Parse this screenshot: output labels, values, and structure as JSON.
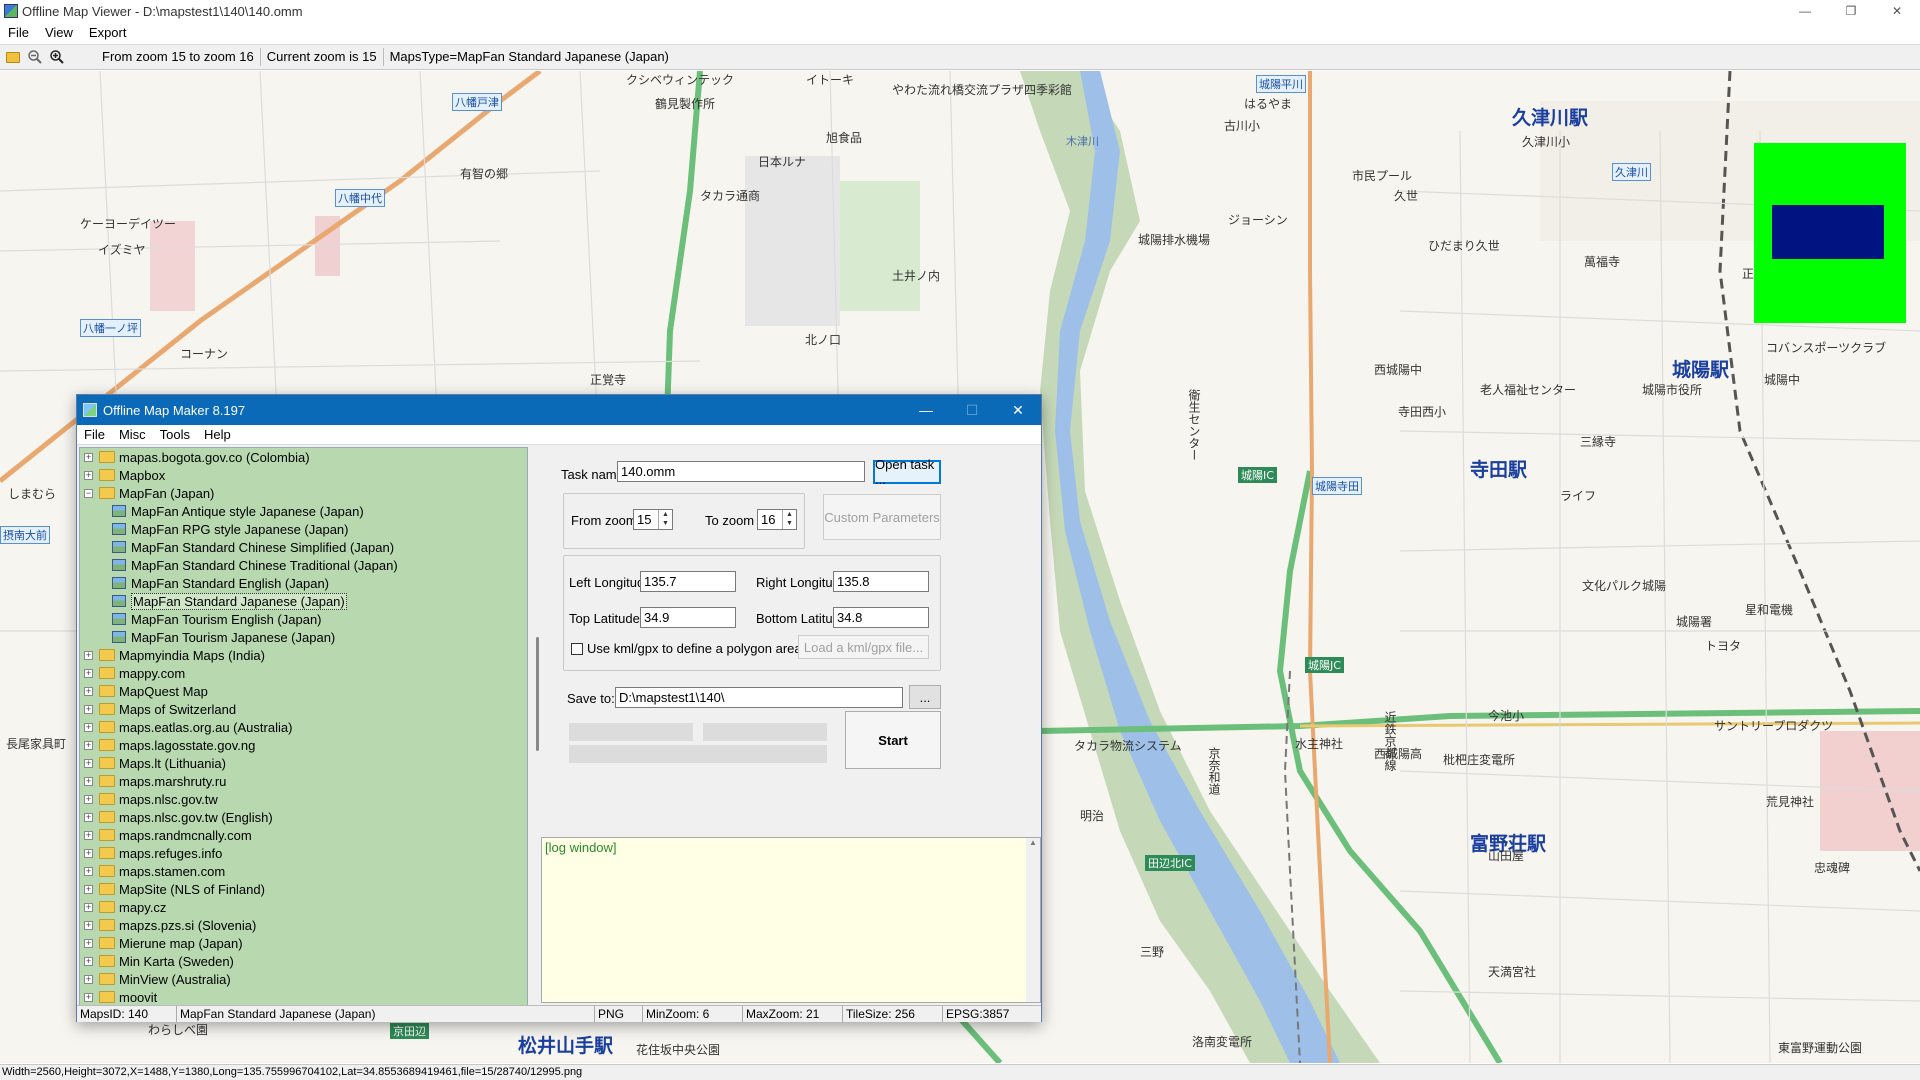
{
  "window": {
    "title": "Offline Map Viewer - D:\\mapstest1\\140\\140.omm",
    "controls": [
      "—",
      "❐",
      "✕"
    ]
  },
  "menu": [
    "File",
    "View",
    "Export"
  ],
  "toolbar": {
    "zoom_range": "From zoom 15 to zoom 16",
    "current_zoom": "Current zoom is 15",
    "maps_type": "MapsType=MapFan Standard Japanese (Japan)"
  },
  "map_labels": {
    "station1": "久津川駅",
    "station2": "城陽駅",
    "station3": "寺田駅",
    "station4": "富野荘駅",
    "station5": "松井山手駅",
    "road1": "城陽平川",
    "road2": "八幡戸津",
    "road3": "八幡中代",
    "road4": "八幡一ノ坪",
    "road5": "久津川",
    "road6": "城陽寺田",
    "road7": "摂南大前",
    "ic1": "城陽IC",
    "ic2": "城陽JC",
    "ic3": "田辺北IC",
    "ic4": "京田辺",
    "p1": "クシベウィンテック",
    "p2": "イトーキ",
    "p3": "やわた流れ橋交流プラザ四季彩館",
    "p4": "鶴見製作所",
    "p5": "旭食品",
    "p6": "日本ルナ",
    "p7": "タカラ通商",
    "p8": "有智の郷",
    "p9": "ケーヨーデイツー",
    "p10": "イズミヤ",
    "p11": "コーナン",
    "p12": "木津川",
    "p13": "城陽排水機場",
    "p14": "市民プール",
    "p15": "ジョーシン",
    "p16": "ひだまり久世",
    "p17": "城陽市役所",
    "p18": "文化パルク城陽",
    "p19": "城陽署",
    "p20": "星和電機",
    "p21": "トヨタ",
    "p22": "サントリープロダクツ",
    "p23": "荒見神社",
    "p24": "水主神社",
    "p25": "タカラ物流システム",
    "p26": "明治",
    "p27": "コバンスポーツクラブ",
    "p28": "正道官衙遺跡",
    "p29": "老人福祉センター",
    "p30": "城陽中",
    "p31": "寺田西小",
    "p32": "三縁寺",
    "p33": "ライフ",
    "p34": "今池小",
    "p35": "枇杷庄変電所",
    "p36": "西城陽高",
    "p37": "西城陽中",
    "p38": "東富野運動公園",
    "p39": "洛南変電所",
    "p40": "花住坂中央公園",
    "p41": "わらしべ園",
    "p42": "天満宮社",
    "p43": "山田屋",
    "p44": "三野",
    "p45": "正覚寺",
    "p46": "土井ノ内",
    "p47": "北ノ口",
    "p48": "萬福寺",
    "p49": "しまむら",
    "p50": "長尾家具町",
    "p51": "忠魂碑",
    "p52": "久世",
    "p53": "はるやま",
    "p54": "古川小",
    "p55": "久津川小",
    "p56": "近鉄京都線",
    "p57": "京奈和道",
    "p58": "衛生センター"
  },
  "statusbar": "Width=2560,Height=3072,X=1488,Y=1380,Long=135.755996704102,Lat=34.8553689419461,file=15/28740/12995.png",
  "dialog": {
    "title": "Offline Map Maker 8.197",
    "controls": [
      "—",
      "☐",
      "✕"
    ],
    "menu": [
      "File",
      "Misc",
      "Tools",
      "Help"
    ],
    "tree": [
      {
        "label": "mapas.bogota.gov.co (Colombia)",
        "level": 0,
        "expander": "+"
      },
      {
        "label": "Mapbox",
        "level": 0,
        "expander": "+"
      },
      {
        "label": "MapFan (Japan)",
        "level": 0,
        "expander": "−",
        "open": true
      },
      {
        "label": "MapFan Antique style Japanese (Japan)",
        "level": 1
      },
      {
        "label": "MapFan RPG style Japanese (Japan)",
        "level": 1
      },
      {
        "label": "MapFan Standard Chinese Simplified (Japan)",
        "level": 1
      },
      {
        "label": "MapFan Standard Chinese Traditional (Japan)",
        "level": 1
      },
      {
        "label": "MapFan Standard English (Japan)",
        "level": 1
      },
      {
        "label": "MapFan Standard Japanese (Japan)",
        "level": 1,
        "selected": true
      },
      {
        "label": "MapFan Tourism English (Japan)",
        "level": 1
      },
      {
        "label": "MapFan Tourism Japanese (Japan)",
        "level": 1
      },
      {
        "label": "Mapmyindia Maps (India)",
        "level": 0,
        "expander": "+"
      },
      {
        "label": "mappy.com",
        "level": 0,
        "expander": "+"
      },
      {
        "label": "MapQuest Map",
        "level": 0,
        "expander": "+"
      },
      {
        "label": "Maps of Switzerland",
        "level": 0,
        "expander": "+"
      },
      {
        "label": "maps.eatlas.org.au (Australia)",
        "level": 0,
        "expander": "+"
      },
      {
        "label": "maps.lagosstate.gov.ng",
        "level": 0,
        "expander": "+"
      },
      {
        "label": "Maps.lt (Lithuania)",
        "level": 0,
        "expander": "+"
      },
      {
        "label": "maps.marshruty.ru",
        "level": 0,
        "expander": "+"
      },
      {
        "label": "maps.nlsc.gov.tw",
        "level": 0,
        "expander": "+"
      },
      {
        "label": "maps.nlsc.gov.tw (English)",
        "level": 0,
        "expander": "+"
      },
      {
        "label": "maps.randmcnally.com",
        "level": 0,
        "expander": "+"
      },
      {
        "label": "maps.refuges.info",
        "level": 0,
        "expander": "+"
      },
      {
        "label": "maps.stamen.com",
        "level": 0,
        "expander": "+"
      },
      {
        "label": "MapSite (NLS of Finland)",
        "level": 0,
        "expander": "+"
      },
      {
        "label": "mapy.cz",
        "level": 0,
        "expander": "+"
      },
      {
        "label": "mapzs.pzs.si (Slovenia)",
        "level": 0,
        "expander": "+"
      },
      {
        "label": "Mierune map (Japan)",
        "level": 0,
        "expander": "+"
      },
      {
        "label": "Min Karta (Sweden)",
        "level": 0,
        "expander": "+"
      },
      {
        "label": "MinView (Australia)",
        "level": 0,
        "expander": "+"
      },
      {
        "label": "moovit",
        "level": 0,
        "expander": "+"
      }
    ],
    "task_name_label": "Task name",
    "task_name_value": "140.omm",
    "open_task_label": "Open task ...",
    "from_zoom_label": "From zoom",
    "from_zoom_value": "15",
    "to_zoom_label": "To zoom",
    "to_zoom_value": "16",
    "custom_params_label": "Custom Parameters",
    "left_long_label": "Left Longitude",
    "left_long_value": "135.7",
    "right_long_label": "Right Longitude",
    "right_long_value": "135.8",
    "top_lat_label": "Top Latitude",
    "top_lat_value": "34.9",
    "bottom_lat_label": "Bottom Latitude",
    "bottom_lat_value": "34.8",
    "kml_label": "Use kml/gpx to define a polygon area",
    "load_kml_label": "Load a kml/gpx file...",
    "save_to_label": "Save to:",
    "save_to_value": "D:\\mapstest1\\140\\",
    "browse_label": "...",
    "start_label": "Start",
    "log_text": "[log window]",
    "status": {
      "maps_id": "MapsID: 140",
      "maps_name": "MapFan Standard Japanese (Japan)",
      "format": "PNG",
      "min_zoom": "MinZoom: 6",
      "max_zoom": "MaxZoom: 21",
      "tile_size": "TileSize: 256",
      "epsg": "EPSG:3857"
    }
  },
  "colors": {
    "dialog_title": "#0b6ab8",
    "tree_bg": "#b8d8b0",
    "minimap_bg": "#00ff00",
    "minimap_view": "#001380",
    "river": "#9ec0e8"
  }
}
